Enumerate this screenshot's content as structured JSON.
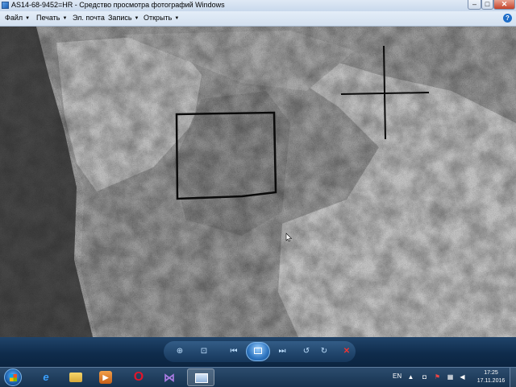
{
  "window": {
    "title": "AS14-68-9452=HR - Средство просмотра фотографий Windows",
    "min_symbol": "–",
    "max_symbol": "□",
    "close_symbol": "✕"
  },
  "menu": {
    "items": [
      {
        "label": "Файл"
      },
      {
        "label": "Печать"
      },
      {
        "label": "Эл. почта"
      },
      {
        "label": "Запись"
      },
      {
        "label": "Открыть"
      }
    ],
    "help_symbol": "?"
  },
  "controls": {
    "zoom_symbol": "⊕",
    "fit_symbol": "⊡",
    "prev_symbol": "⏮",
    "next_symbol": "⏭",
    "rotate_ccw_symbol": "↺",
    "rotate_cw_symbol": "↻",
    "delete_symbol": "✕"
  },
  "taskbar": {
    "apps": [
      {
        "name": "internet-explorer",
        "glyph": "e"
      },
      {
        "name": "explorer-folder",
        "glyph": ""
      },
      {
        "name": "media-player",
        "glyph": "▶"
      },
      {
        "name": "opera",
        "glyph": "O"
      },
      {
        "name": "visual-studio",
        "glyph": "⋈"
      },
      {
        "name": "photo-viewer",
        "glyph": ""
      }
    ],
    "language": "EN",
    "time": "17:25",
    "date": "17.11.2016"
  },
  "colors": {
    "titlebar": "#dfe9f5",
    "controlbar": "#0f2c4c",
    "taskbar": "#16324f",
    "delete": "#e33333"
  }
}
